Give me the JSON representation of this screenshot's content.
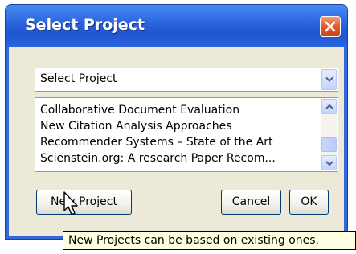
{
  "window": {
    "title": "Select Project",
    "close_icon": "close-icon"
  },
  "combo": {
    "value": "Select Project",
    "arrow_icon": "chevron-down-icon"
  },
  "list": {
    "items": [
      "Collaborative Document Evaluation",
      "New Citation Analysis Approaches",
      "Recommender Systems – State of the Art",
      "Scienstein.org: A research Paper Recom..."
    ]
  },
  "buttons": {
    "new_project": "New Project",
    "cancel": "Cancel",
    "ok": "OK"
  },
  "tooltip": {
    "text": "New Projects can be based on existing ones."
  },
  "colors": {
    "titlebar": "#2b63dc",
    "client_bg": "#ece9d8",
    "close_button": "#e05a2a",
    "tooltip_bg": "#ffffe1"
  }
}
